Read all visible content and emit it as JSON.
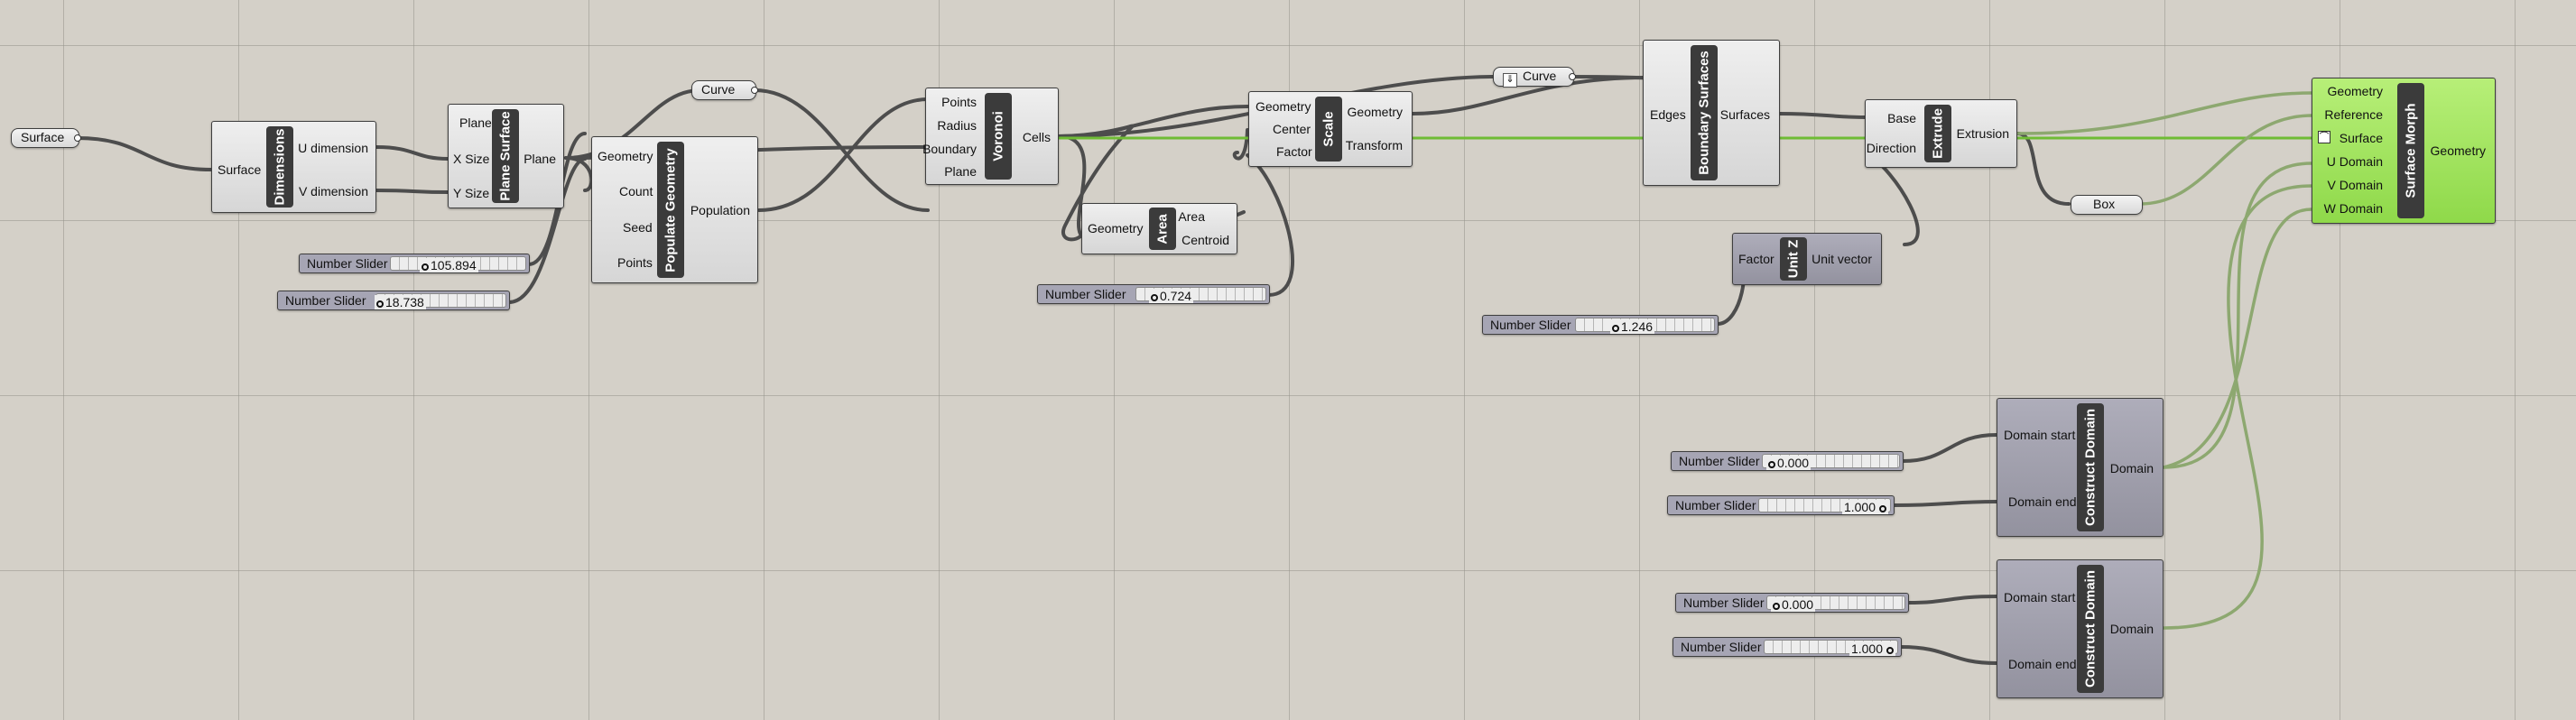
{
  "params": {
    "surface": "Surface",
    "curve1": "Curve",
    "curve2": "Curve",
    "box": "Box"
  },
  "icons": {
    "curve2": "internalised-data-icon",
    "surface_input": "reparameterize-icon"
  },
  "components": {
    "dimensions": {
      "title": "Dimensions",
      "in": [
        "Surface"
      ],
      "out": [
        "U dimension",
        "V dimension"
      ]
    },
    "plane_surface": {
      "title": "Plane Surface",
      "in": [
        "Plane",
        "X Size",
        "Y Size"
      ],
      "out": [
        "Plane"
      ]
    },
    "populate": {
      "title": "Populate Geometry",
      "in": [
        "Geometry",
        "Count",
        "Seed",
        "Points"
      ],
      "out": [
        "Population"
      ]
    },
    "voronoi": {
      "title": "Voronoi",
      "in": [
        "Points",
        "Radius",
        "Boundary",
        "Plane"
      ],
      "out": [
        "Cells"
      ]
    },
    "area": {
      "title": "Area",
      "in": [
        "Geometry"
      ],
      "out": [
        "Area",
        "Centroid"
      ]
    },
    "scale": {
      "title": "Scale",
      "in": [
        "Geometry",
        "Center",
        "Factor"
      ],
      "out": [
        "Geometry",
        "Transform"
      ]
    },
    "boundary": {
      "title": "Boundary Surfaces",
      "in": [
        "Edges"
      ],
      "out": [
        "Surfaces"
      ]
    },
    "extrude": {
      "title": "Extrude",
      "in": [
        "Base",
        "Direction"
      ],
      "out": [
        "Extrusion"
      ]
    },
    "unitz": {
      "title": "Unit Z",
      "in": [
        "Factor"
      ],
      "out": [
        "Unit vector"
      ]
    },
    "morph": {
      "title": "Surface Morph",
      "in": [
        "Geometry",
        "Reference",
        "Surface",
        "U Domain",
        "V Domain",
        "W Domain"
      ],
      "out": [
        "Geometry"
      ]
    },
    "domain1": {
      "title": "Construct Domain",
      "in": [
        "Domain start",
        "Domain end"
      ],
      "out": [
        "Domain"
      ]
    },
    "domain2": {
      "title": "Construct Domain",
      "in": [
        "Domain start",
        "Domain end"
      ],
      "out": [
        "Domain"
      ]
    }
  },
  "sliders": {
    "s1": {
      "label": "Number Slider",
      "value": "105.894"
    },
    "s2": {
      "label": "Number Slider",
      "value": "18.738"
    },
    "s3": {
      "label": "Number Slider",
      "value": "0.724"
    },
    "s4": {
      "label": "Number Slider",
      "value": "1.246"
    },
    "s5": {
      "label": "Number Slider",
      "value": "0.000"
    },
    "s6": {
      "label": "Number Slider",
      "value": "1.000"
    },
    "s7": {
      "label": "Number Slider",
      "value": "0.000"
    },
    "s8": {
      "label": "Number Slider",
      "value": "1.000"
    }
  },
  "colors": {
    "canvas": "#d4d0c8",
    "wire": "#4a4a4a",
    "wire_selected": "#7dc43a",
    "component_selected": "#8fd94a"
  }
}
